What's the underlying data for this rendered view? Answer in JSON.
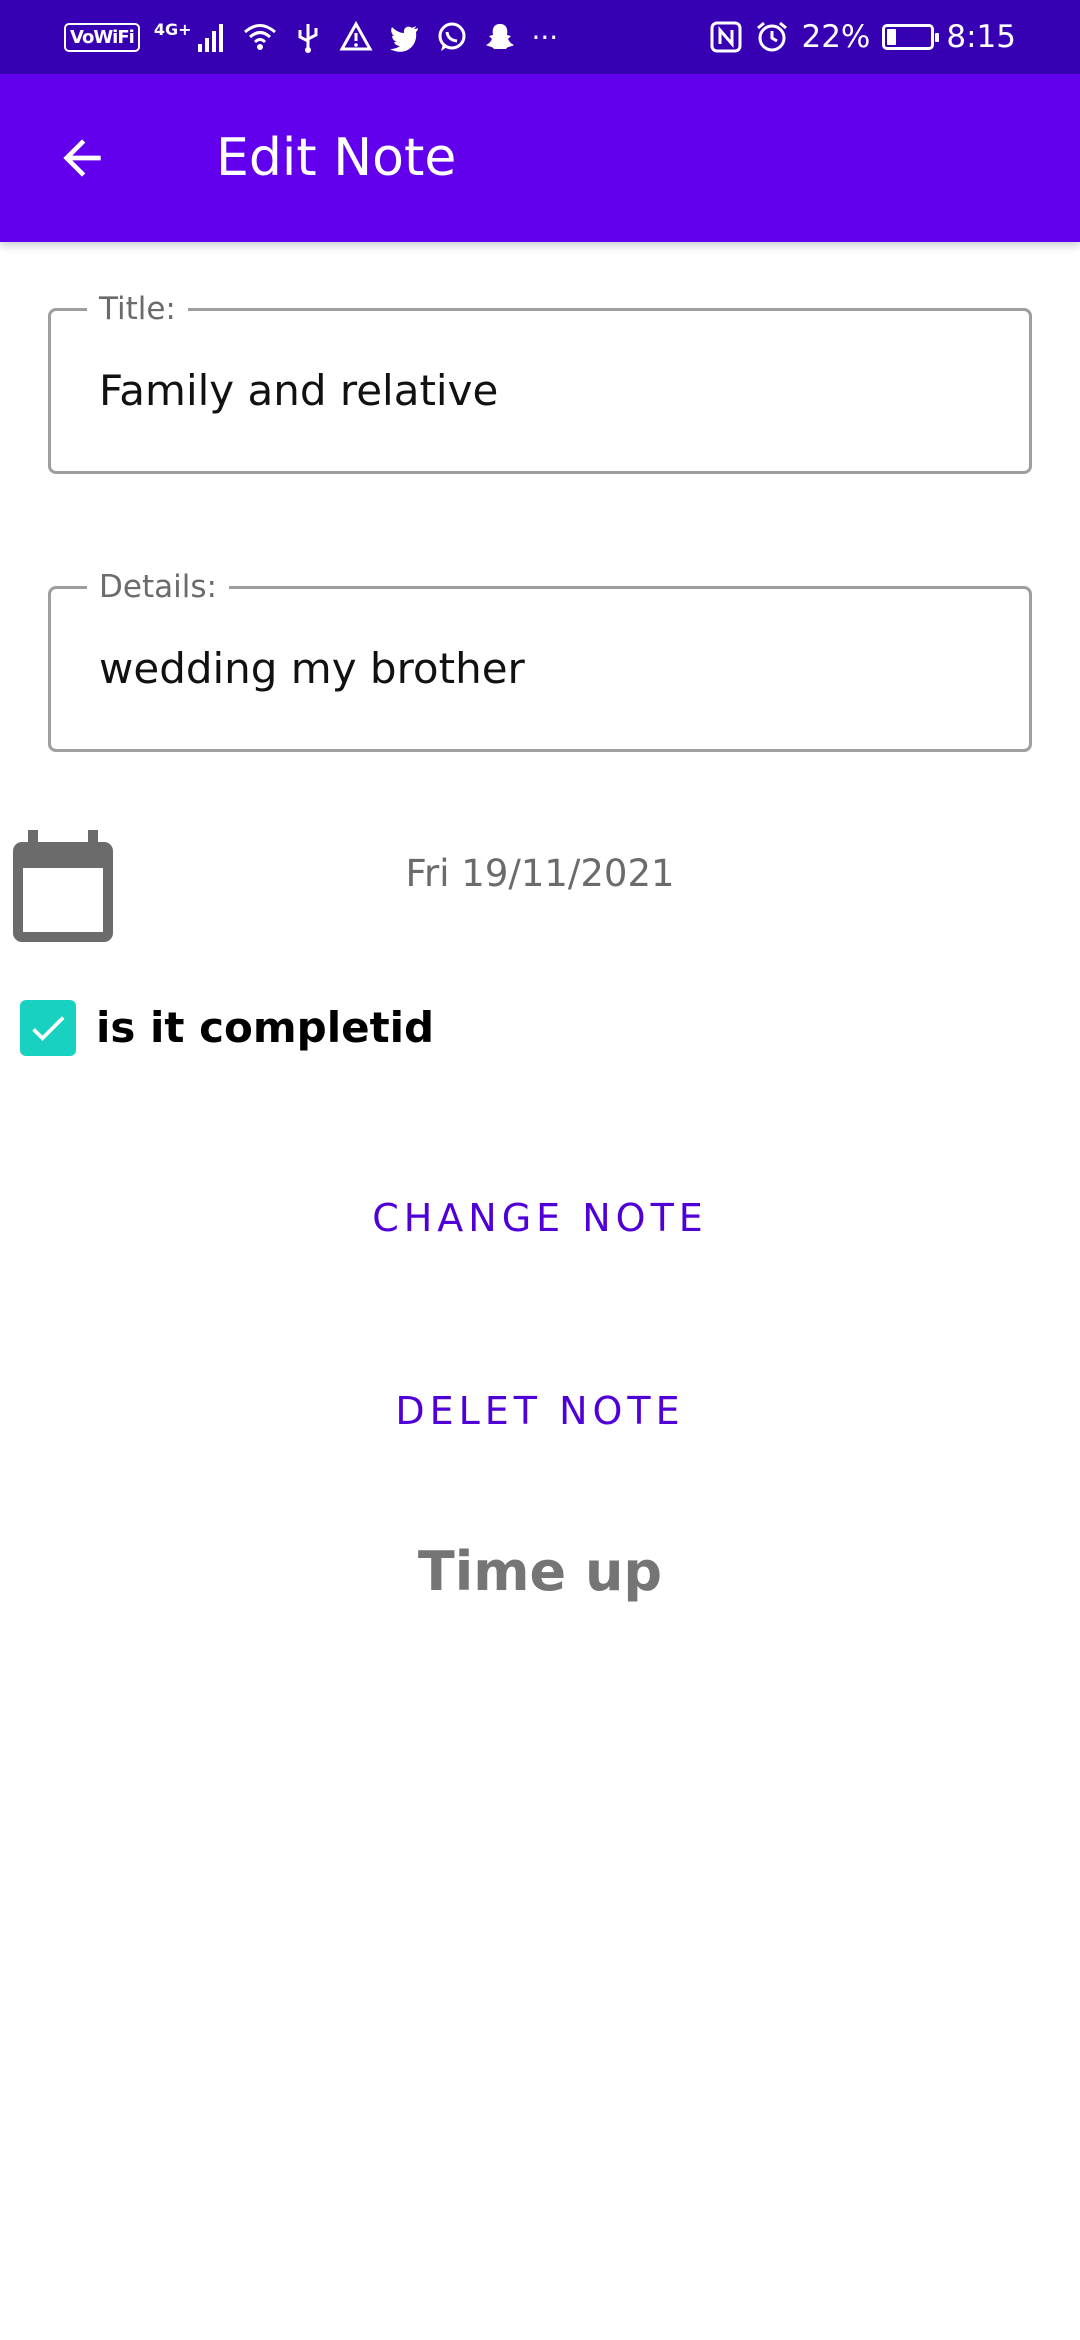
{
  "status_bar": {
    "vowifi": "VoWiFi",
    "network": "4G+",
    "battery_percent": "22%",
    "battery_level": 0.22,
    "time": "8:15",
    "more": "···",
    "left_icons": [
      "signal-icon",
      "wifi-icon",
      "usb-icon",
      "warning-icon",
      "twitter-icon",
      "whatsapp-icon",
      "snapchat-icon"
    ],
    "right_icons": [
      "nfc-icon",
      "alarm-icon",
      "battery-icon"
    ]
  },
  "app_bar": {
    "back_icon": "arrow-back-icon",
    "title": "Edit Note",
    "color": "#6200ee"
  },
  "form": {
    "title_label": "Title:",
    "title_value": "Family and relative",
    "details_label": "Details:",
    "details_value": "wedding my brother",
    "date_icon": "calendar-icon",
    "date": "Fri 19/11/2021",
    "completed_label": "is it completid",
    "completed_checked": true
  },
  "actions": {
    "change_label": "CHANGE NOTE",
    "delete_label": "DELET NOTE"
  },
  "status_text": "Time up",
  "colors": {
    "status_bar": "#3700b3",
    "app_bar": "#6200ee",
    "accent_text": "#5000d6",
    "checkbox": "#18d1c0"
  }
}
